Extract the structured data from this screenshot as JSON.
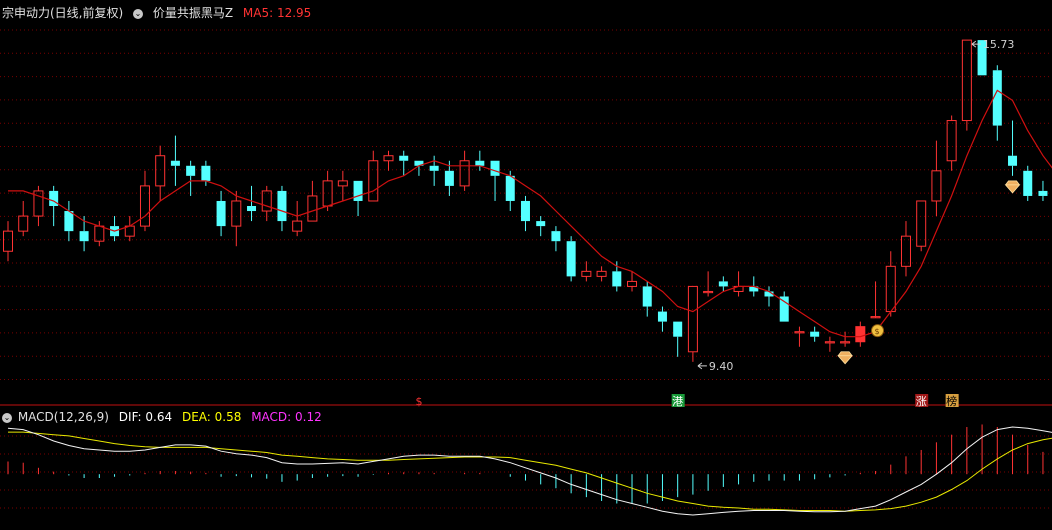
{
  "main_header": {
    "title": "宗申动力(日线,前复权)",
    "indicator_icon": "chevron-down-circle-icon",
    "indicator": "价量共振黑马Z",
    "ma_label": "MA5: 12.95",
    "ma_color": "#ff3333"
  },
  "macd_header": {
    "icon": "chevron-down-circle-icon",
    "name": "MACD(12,26,9)",
    "dif_label": "DIF: 0.64",
    "dea_label": "DEA: 0.58",
    "macd_label": "MACD: 0.12",
    "dif_color": "#ffffff",
    "dea_color": "#ffff00",
    "macd_color": "#ff33ff"
  },
  "colors": {
    "up": "#ff3333",
    "down": "#54ffff",
    "ma_line": "#d01010",
    "grid": "#7a0000",
    "signal_bar": "#ffee00",
    "background": "#000000"
  },
  "chart_data": [
    {
      "type": "candlestick",
      "y_range": [
        8.8,
        16.2
      ],
      "max_annotation": "15.73",
      "min_annotation": "9.40",
      "candles": [
        [
          11.6,
          12.0,
          11.4,
          12.2
        ],
        [
          12.0,
          12.3,
          11.9,
          12.6
        ],
        [
          12.3,
          12.8,
          12.1,
          12.9
        ],
        [
          12.8,
          12.5,
          12.1,
          12.9
        ],
        [
          12.4,
          12.0,
          11.8,
          12.6
        ],
        [
          12.0,
          11.8,
          11.6,
          12.3
        ],
        [
          11.8,
          12.1,
          11.7,
          12.2
        ],
        [
          12.1,
          11.9,
          11.8,
          12.3
        ],
        [
          11.9,
          12.1,
          11.8,
          12.3
        ],
        [
          12.1,
          12.9,
          12.0,
          13.2
        ],
        [
          12.9,
          13.5,
          12.6,
          13.7
        ],
        [
          13.4,
          13.3,
          12.9,
          13.9
        ],
        [
          13.3,
          13.1,
          12.7,
          13.4
        ],
        [
          13.3,
          13.0,
          12.9,
          13.4
        ],
        [
          12.6,
          12.1,
          11.9,
          12.8
        ],
        [
          12.1,
          12.6,
          11.7,
          12.8
        ],
        [
          12.5,
          12.4,
          12.2,
          12.9
        ],
        [
          12.4,
          12.8,
          12.2,
          12.9
        ],
        [
          12.8,
          12.2,
          12.0,
          12.9
        ],
        [
          12.0,
          12.2,
          11.9,
          12.6
        ],
        [
          12.2,
          12.7,
          12.2,
          13.0
        ],
        [
          12.5,
          13.0,
          12.4,
          13.2
        ],
        [
          12.9,
          13.0,
          12.6,
          13.2
        ],
        [
          13.0,
          12.6,
          12.3,
          13.0
        ],
        [
          12.6,
          13.4,
          12.6,
          13.6
        ],
        [
          13.4,
          13.5,
          13.2,
          13.6
        ],
        [
          13.5,
          13.4,
          13.1,
          13.6
        ],
        [
          13.4,
          13.3,
          13.1,
          13.4
        ],
        [
          13.3,
          13.2,
          12.9,
          13.5
        ],
        [
          13.2,
          12.9,
          12.7,
          13.4
        ],
        [
          12.9,
          13.4,
          12.8,
          13.6
        ],
        [
          13.4,
          13.3,
          13.2,
          13.6
        ],
        [
          13.4,
          13.1,
          12.6,
          13.4
        ],
        [
          13.1,
          12.6,
          12.4,
          13.2
        ],
        [
          12.6,
          12.2,
          12.0,
          12.7
        ],
        [
          12.2,
          12.1,
          11.9,
          12.3
        ],
        [
          12.0,
          11.8,
          11.6,
          12.1
        ],
        [
          11.8,
          11.1,
          11.0,
          11.9
        ],
        [
          11.1,
          11.2,
          11.0,
          11.4
        ],
        [
          11.1,
          11.2,
          11.0,
          11.3
        ],
        [
          11.2,
          10.9,
          10.8,
          11.4
        ],
        [
          10.9,
          11.0,
          10.8,
          11.2
        ],
        [
          10.9,
          10.5,
          10.3,
          11.0
        ],
        [
          10.4,
          10.2,
          10.0,
          10.5
        ],
        [
          10.2,
          9.9,
          9.5,
          10.2
        ],
        [
          9.6,
          10.9,
          9.4,
          10.9
        ],
        [
          10.8,
          10.8,
          10.7,
          11.2
        ],
        [
          11.0,
          10.9,
          10.8,
          11.1
        ],
        [
          10.8,
          10.9,
          10.7,
          11.2
        ],
        [
          10.9,
          10.8,
          10.7,
          11.1
        ],
        [
          10.8,
          10.7,
          10.5,
          10.9
        ],
        [
          10.7,
          10.2,
          10.2,
          10.8
        ],
        [
          10.0,
          10.0,
          9.7,
          10.1
        ],
        [
          10.0,
          9.9,
          9.8,
          10.1
        ],
        [
          9.8,
          9.8,
          9.6,
          9.9
        ],
        [
          9.8,
          9.8,
          9.7,
          10.0
        ],
        [
          9.8,
          10.1,
          9.7,
          10.2
        ],
        [
          10.3,
          10.3,
          10.3,
          11.0
        ],
        [
          10.4,
          11.3,
          10.3,
          11.6
        ],
        [
          11.3,
          11.9,
          11.1,
          12.2
        ],
        [
          11.7,
          12.6,
          11.6,
          12.6
        ],
        [
          12.6,
          13.2,
          12.3,
          13.8
        ],
        [
          13.4,
          14.2,
          13.2,
          14.3
        ],
        [
          14.2,
          15.8,
          14.0,
          15.8
        ],
        [
          15.8,
          15.1,
          15.1,
          15.8
        ],
        [
          15.2,
          14.1,
          13.8,
          15.3
        ],
        [
          13.5,
          13.3,
          13.1,
          14.2
        ],
        [
          13.2,
          12.7,
          12.6,
          13.3
        ],
        [
          12.8,
          12.7,
          12.6,
          13.0
        ],
        [
          12.7,
          12.9,
          12.5,
          12.9
        ]
      ],
      "ma5": [
        12.8,
        12.8,
        12.7,
        12.6,
        12.4,
        12.2,
        12.1,
        12.0,
        12.1,
        12.3,
        12.6,
        12.8,
        13.0,
        13.0,
        12.9,
        12.7,
        12.6,
        12.5,
        12.4,
        12.3,
        12.4,
        12.5,
        12.6,
        12.7,
        12.8,
        13.0,
        13.1,
        13.3,
        13.4,
        13.3,
        13.3,
        13.3,
        13.2,
        13.1,
        12.9,
        12.7,
        12.4,
        12.1,
        11.8,
        11.5,
        11.3,
        11.2,
        11.0,
        10.8,
        10.5,
        10.4,
        10.6,
        10.8,
        10.9,
        10.9,
        10.8,
        10.6,
        10.4,
        10.2,
        10.0,
        9.9,
        9.9,
        10.0,
        10.4,
        10.8,
        11.3,
        12.0,
        12.7,
        13.5,
        14.2,
        14.8,
        14.6,
        14.0,
        13.5,
        13.1
      ],
      "signal_bar_indices": [
        56,
        57
      ],
      "markers": [
        {
          "type": "money-bag",
          "index": 57
        },
        {
          "type": "gem",
          "index": 55
        },
        {
          "type": "gem",
          "index": 66
        }
      ]
    },
    {
      "type": "macd",
      "y_range": [
        -0.75,
        0.85
      ],
      "hist": [
        0.2,
        0.18,
        0.1,
        0.04,
        -0.02,
        -0.06,
        -0.06,
        -0.04,
        -0.02,
        0.02,
        0.05,
        0.05,
        0.04,
        0.02,
        -0.04,
        -0.03,
        -0.05,
        -0.07,
        -0.12,
        -0.1,
        -0.06,
        -0.04,
        -0.03,
        -0.04,
        -0.01,
        0.02,
        0.03,
        0.03,
        0.02,
        0.0,
        0.02,
        0.02,
        0.0,
        -0.04,
        -0.1,
        -0.16,
        -0.22,
        -0.3,
        -0.36,
        -0.42,
        -0.46,
        -0.46,
        -0.46,
        -0.42,
        -0.36,
        -0.32,
        -0.26,
        -0.2,
        -0.16,
        -0.12,
        -0.1,
        -0.1,
        -0.1,
        -0.08,
        -0.05,
        -0.02,
        0.02,
        0.05,
        0.15,
        0.28,
        0.38,
        0.5,
        0.62,
        0.74,
        0.78,
        0.74,
        0.62,
        0.46,
        0.35,
        0.24
      ],
      "dif": [
        0.72,
        0.7,
        0.62,
        0.52,
        0.45,
        0.4,
        0.38,
        0.36,
        0.36,
        0.38,
        0.42,
        0.46,
        0.46,
        0.44,
        0.36,
        0.32,
        0.3,
        0.26,
        0.18,
        0.16,
        0.16,
        0.17,
        0.18,
        0.16,
        0.2,
        0.24,
        0.28,
        0.3,
        0.3,
        0.28,
        0.28,
        0.28,
        0.24,
        0.18,
        0.1,
        0.02,
        -0.06,
        -0.16,
        -0.24,
        -0.32,
        -0.4,
        -0.46,
        -0.52,
        -0.58,
        -0.62,
        -0.64,
        -0.62,
        -0.6,
        -0.58,
        -0.57,
        -0.57,
        -0.57,
        -0.58,
        -0.59,
        -0.59,
        -0.58,
        -0.54,
        -0.5,
        -0.4,
        -0.28,
        -0.16,
        0.0,
        0.18,
        0.4,
        0.58,
        0.7,
        0.74,
        0.72,
        0.68,
        0.64
      ],
      "dea": [
        0.66,
        0.66,
        0.64,
        0.62,
        0.6,
        0.56,
        0.52,
        0.48,
        0.45,
        0.43,
        0.42,
        0.42,
        0.42,
        0.42,
        0.4,
        0.38,
        0.36,
        0.34,
        0.3,
        0.28,
        0.26,
        0.24,
        0.23,
        0.22,
        0.22,
        0.22,
        0.23,
        0.24,
        0.25,
        0.26,
        0.27,
        0.27,
        0.27,
        0.26,
        0.22,
        0.18,
        0.14,
        0.08,
        0.02,
        -0.06,
        -0.14,
        -0.22,
        -0.3,
        -0.36,
        -0.42,
        -0.46,
        -0.5,
        -0.52,
        -0.53,
        -0.55,
        -0.55,
        -0.56,
        -0.57,
        -0.57,
        -0.57,
        -0.58,
        -0.57,
        -0.56,
        -0.54,
        -0.5,
        -0.44,
        -0.36,
        -0.24,
        -0.1,
        0.08,
        0.24,
        0.38,
        0.48,
        0.54,
        0.58
      ]
    }
  ],
  "bottom_badges": [
    {
      "text": "$",
      "color": "#ff3333",
      "bg": "",
      "index": 27
    },
    {
      "text": "港",
      "color": "#ffffff",
      "bg": "#1a9a3a",
      "index": 44
    },
    {
      "text": "涨",
      "color": "#ffffff",
      "bg": "#a01818",
      "index": 60
    },
    {
      "text": "榜",
      "color": "#000000",
      "bg": "#d8a040",
      "index": 62
    }
  ]
}
